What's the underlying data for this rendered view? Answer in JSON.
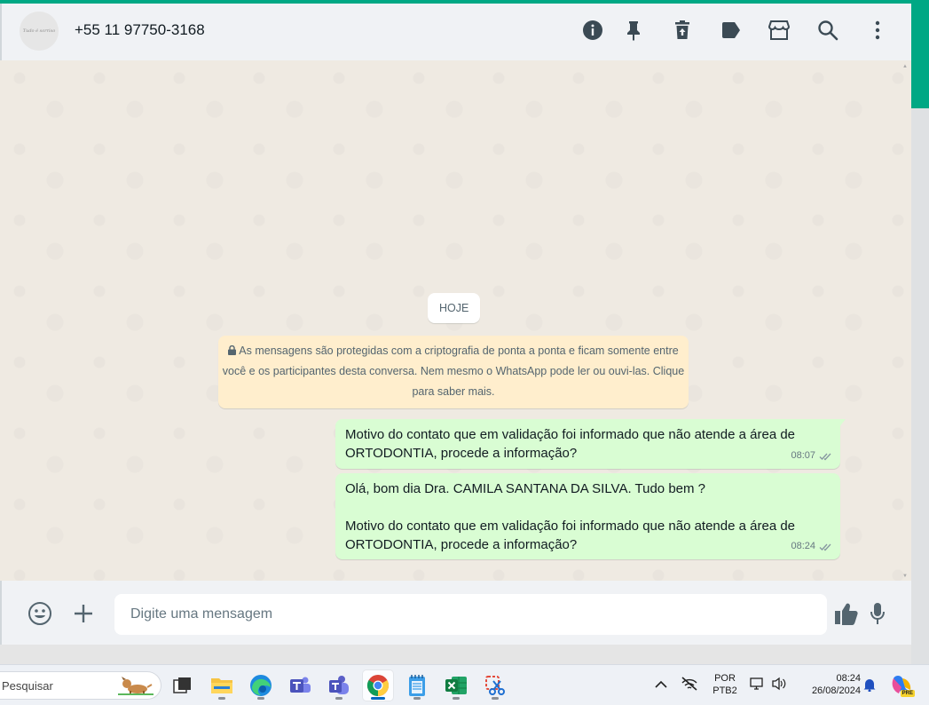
{
  "header": {
    "avatar_text": "Tudo é sorriso",
    "contact": "+55 11 97750-3168",
    "icons": [
      "info-icon",
      "pin-icon",
      "delete-icon",
      "label-icon",
      "store-icon",
      "search-icon",
      "menu-icon"
    ]
  },
  "chat": {
    "date_pill": "HOJE",
    "encryption_notice": "As mensagens são protegidas com a criptografia de ponta a ponta e ficam somente entre você e os participantes desta conversa. Nem mesmo o WhatsApp pode ler ou ouvi-las. Clique para saber mais.",
    "messages": [
      {
        "text": "Motivo do contato que em validação foi informado que não atende a área de ORTODONTIA, procede a informação?",
        "time": "08:07",
        "status": "delivered"
      },
      {
        "text": "Olá, bom dia Dra. CAMILA SANTANA DA SILVA. Tudo bem ?\n\nMotivo do contato que em validação foi informado que não atende a área de ORTODONTIA, procede a informação?",
        "time": "08:24",
        "status": "delivered"
      }
    ]
  },
  "composer": {
    "placeholder": "Digite uma mensagem"
  },
  "taskbar": {
    "search_label": "Pesquisar",
    "apps": [
      "task-view",
      "file-explorer",
      "edge",
      "teams-classic",
      "teams",
      "chrome",
      "notepad",
      "excel",
      "snipping-tool"
    ],
    "active_app": "chrome",
    "lang_top": "POR",
    "lang_bottom": "PTB2",
    "time": "08:24",
    "date": "26/08/2024",
    "copilot_badge": "PRE"
  },
  "colors": {
    "accent": "#00a884",
    "outgoing_bubble": "#d9fdd3",
    "system_notice": "#ffeecd",
    "icon": "#54656f"
  }
}
